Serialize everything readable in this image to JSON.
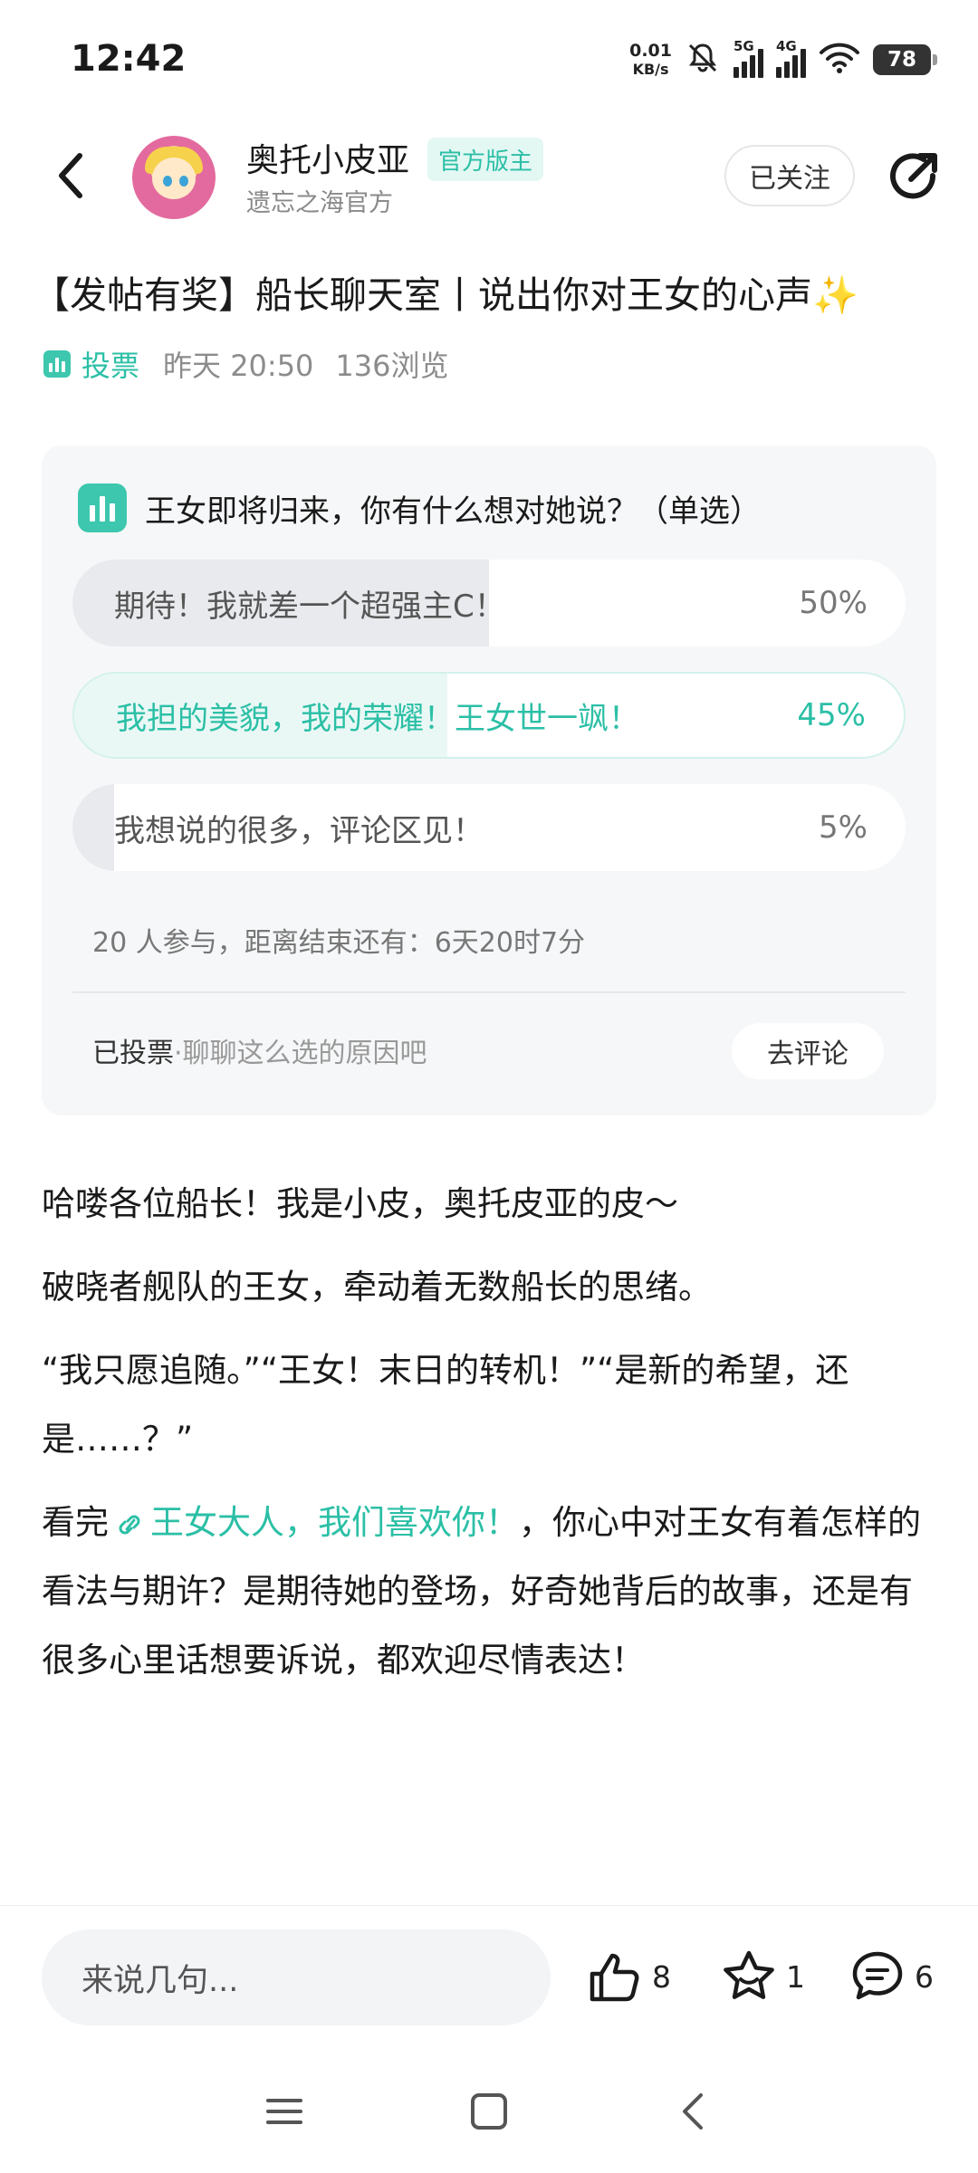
{
  "status_bar": {
    "time": "12:42",
    "net_speed_value": "0.01",
    "net_speed_unit": "KB/s",
    "signal1_label": "5G",
    "signal2_label": "4G",
    "battery": "78"
  },
  "header": {
    "author_name": "奥托小皮亚",
    "official_tag": "官方版主",
    "author_sub": "遗忘之海官方",
    "follow_label": "已关注"
  },
  "post": {
    "title": "【发帖有奖】船长聊天室丨说出你对王女的心声✨",
    "type_tag": "投票",
    "time": "昨天 20:50",
    "views": "136浏览"
  },
  "poll": {
    "question": "王女即将归来，你有什么想对她说？（单选）",
    "options": [
      {
        "text": "期待！我就差一个超强主C！",
        "percent": "50%",
        "fraction": 0.5,
        "selected": false
      },
      {
        "text": "我担的美貌，我的荣耀！王女世一飒！",
        "percent": "45%",
        "fraction": 0.45,
        "selected": true
      },
      {
        "text": "我想说的很多，评论区见！",
        "percent": "5%",
        "fraction": 0.05,
        "selected": false
      }
    ],
    "stats": "20 人参与，距离结束还有：6天20时7分",
    "voted_label": "已投票",
    "voted_hint": "·聊聊这么选的原因吧",
    "comment_button": "去评论"
  },
  "body": {
    "p1": "哈喽各位船长！我是小皮，奥托皮亚的皮～",
    "p2": "破晓者舰队的王女，牵动着无数船长的思绪。",
    "p3": "“我只愿追随。”“王女！末日的转机！”“是新的希望，还是……？”",
    "p4_pre": "看完",
    "p4_link": "王女大人，我们喜欢你！",
    "p4_post": "，你心中对王女有着怎样的看法与期许？是期待她的登场，好奇她背后的故事，还是有很多心里话想要诉说，都欢迎尽情表达！"
  },
  "bottom_bar": {
    "input_placeholder": "来说几句...",
    "like_count": "8",
    "star_count": "1",
    "comment_count": "6"
  },
  "colors": {
    "accent": "#2bbfa6",
    "card_bg": "#f6f7f8"
  }
}
